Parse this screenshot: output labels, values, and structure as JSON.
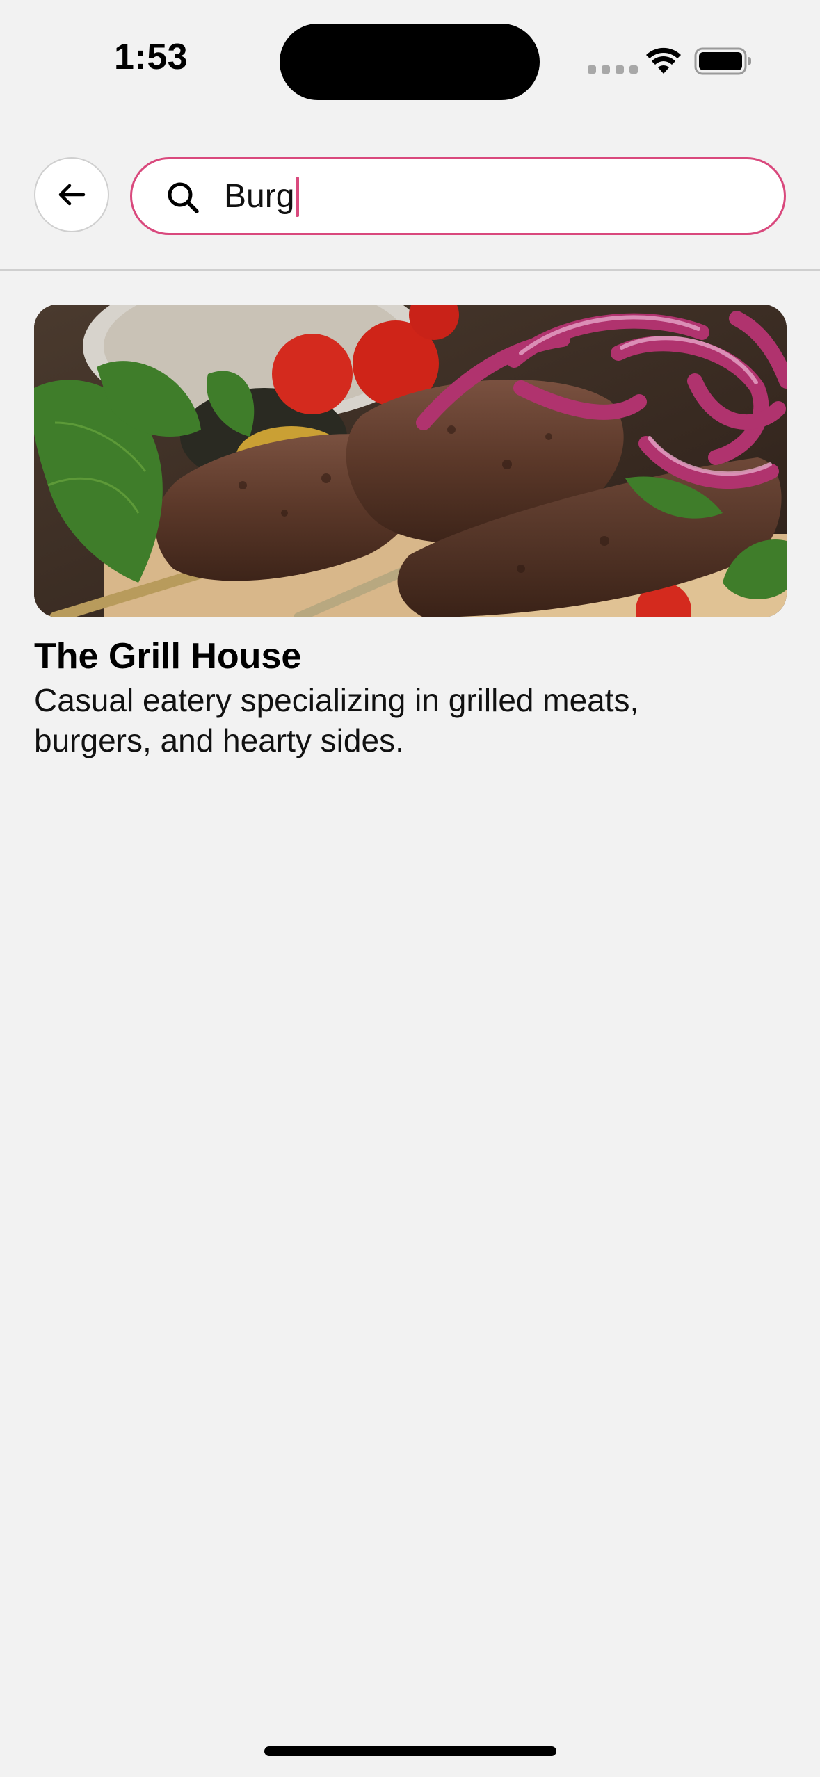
{
  "status_bar": {
    "time": "1:53",
    "icons": [
      "signal-dots-icon",
      "wifi-icon",
      "battery-icon"
    ]
  },
  "search": {
    "query": "Burg",
    "icon": "search-icon",
    "back_icon": "arrow-left-icon"
  },
  "results": [
    {
      "title": "The Grill House",
      "description": "Casual eatery specializing in grilled meats, burgers, and hearty sides.",
      "image": "grilled-kebab-photo"
    }
  ],
  "colors": {
    "accent": "#d9497d",
    "background": "#f2f2f2",
    "surface": "#ffffff",
    "text": "#000000"
  }
}
